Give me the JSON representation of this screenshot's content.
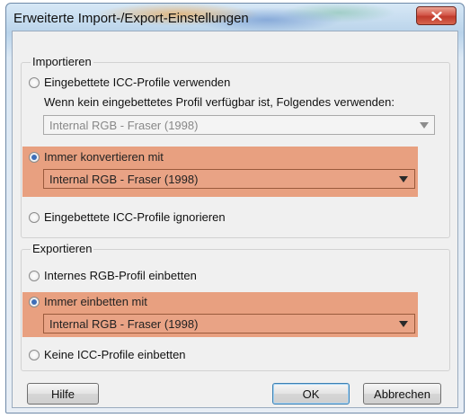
{
  "window": {
    "title": "Erweiterte Import-/Export-Einstellungen"
  },
  "import_group": {
    "label": "Importieren",
    "use_embedded_label": "Eingebettete ICC-Profile verwenden",
    "fallback_note": "Wenn kein eingebettetes Profil verfügbar ist, Folgendes verwenden:",
    "fallback_select_value": "Internal RGB - Fraser (1998)",
    "always_convert_label": "Immer konvertieren mit",
    "always_convert_select_value": "Internal RGB - Fraser (1998)",
    "ignore_embedded_label": "Eingebettete ICC-Profile ignorieren",
    "selected_option": "always_convert"
  },
  "export_group": {
    "label": "Exportieren",
    "embed_internal_label": "Internes RGB-Profil einbetten",
    "always_embed_label": "Immer einbetten mit",
    "always_embed_select_value": "Internal RGB - Fraser (1998)",
    "no_profiles_label": "Keine ICC-Profile einbetten",
    "selected_option": "always_embed"
  },
  "buttons": {
    "help": "Hilfe",
    "ok": "OK",
    "cancel": "Abbrechen"
  },
  "icons": {
    "close": "close-icon",
    "dropdown": "chevron-down-icon"
  },
  "colors": {
    "highlight": "#e8a080",
    "title_close_red": "#c03a2c",
    "radio_checked": "#3d6eb8"
  }
}
